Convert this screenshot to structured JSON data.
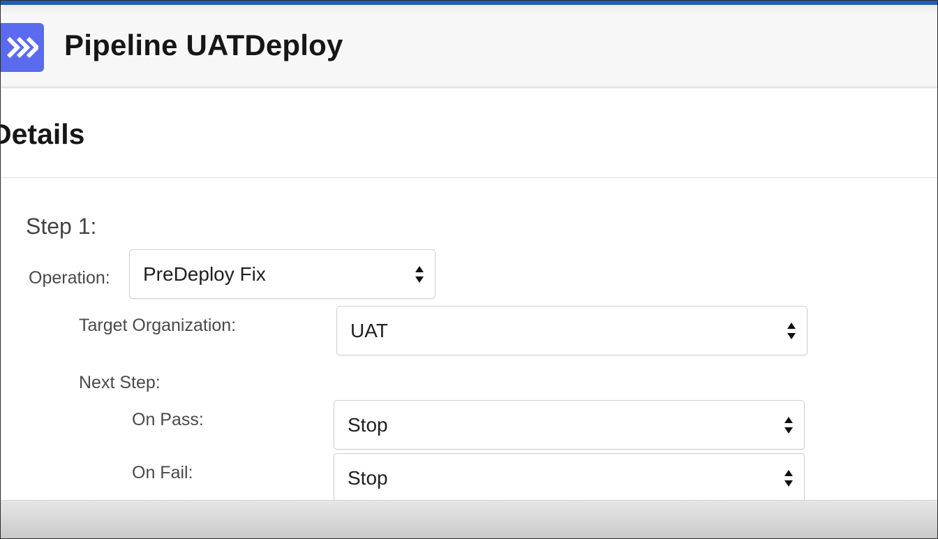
{
  "header": {
    "title": "Pipeline UATDeploy",
    "icon": "double-chevron-right-icon",
    "icon_color": "#5a6bf0",
    "accent_color": "#1b5fbd"
  },
  "section": {
    "title": "Details"
  },
  "step": {
    "title": "Step 1:",
    "operation": {
      "label": "Operation:",
      "value": "PreDeploy Fix"
    },
    "target_org": {
      "label": "Target Organization:",
      "value": "UAT"
    },
    "next_step": {
      "label": "Next Step:",
      "on_pass": {
        "label": "On Pass:",
        "value": "Stop"
      },
      "on_fail": {
        "label": "On Fail:",
        "value": "Stop"
      }
    }
  }
}
